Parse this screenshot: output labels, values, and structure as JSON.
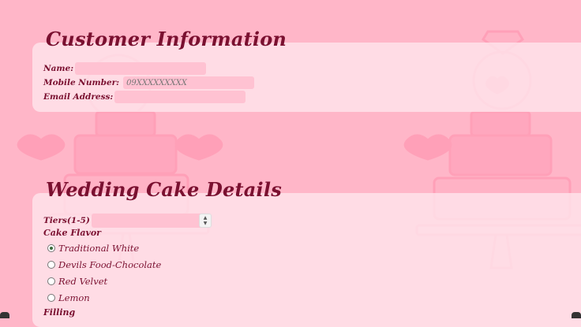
{
  "customer": {
    "heading": "Customer Information",
    "name_label": "Name:",
    "mobile_label": "Mobile Number:",
    "mobile_placeholder": "09XXXXXXXXX",
    "email_label": "Email Address:"
  },
  "cake": {
    "heading": "Wedding Cake Details",
    "tiers_label": "Tiers(1-5)",
    "flavor_label": "Cake Flavor",
    "flavors": [
      {
        "label": "Traditional White",
        "checked": true
      },
      {
        "label": "Devils Food-Chocolate",
        "checked": false
      },
      {
        "label": "Red Velvet",
        "checked": false
      },
      {
        "label": "Lemon",
        "checked": false
      }
    ],
    "filling_label": "Filling"
  }
}
